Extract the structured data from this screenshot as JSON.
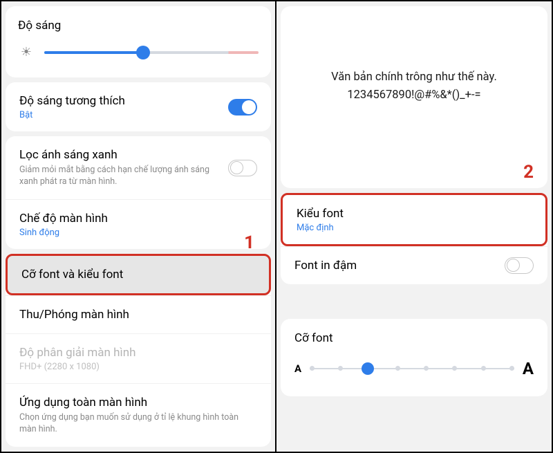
{
  "left": {
    "brightness": {
      "title": "Độ sáng"
    },
    "adaptive": {
      "title": "Độ sáng tương thích",
      "sub": "Bật"
    },
    "bluelight": {
      "title": "Lọc ánh sáng xanh",
      "desc": "Giảm mỏi mắt bằng cách hạn chế lượng ánh sáng xanh phát ra từ màn hình."
    },
    "screenmode": {
      "title": "Chế độ màn hình",
      "sub": "Sinh động"
    },
    "fontstyle": {
      "title": "Cỡ font và kiểu font"
    },
    "zoom": {
      "title": "Thu/Phóng màn hình"
    },
    "resolution": {
      "title": "Độ phân giải màn hình",
      "sub": "FHD+ (2280 x 1080)"
    },
    "fullscreen": {
      "title": "Ứng dụng toàn màn hình",
      "desc": "Chọn ứng dụng bạn muốn sử dụng ở tỉ lệ khung hình toàn màn hình."
    },
    "step": "1"
  },
  "right": {
    "preview": {
      "line1": "Văn bản chính trông như thế này.",
      "line2": "1234567890!@#%&*()_+-="
    },
    "fontstyle": {
      "title": "Kiểu font",
      "sub": "Mặc định"
    },
    "bold": {
      "title": "Font in đậm"
    },
    "fontsize": {
      "title": "Cỡ font"
    },
    "step": "2"
  }
}
